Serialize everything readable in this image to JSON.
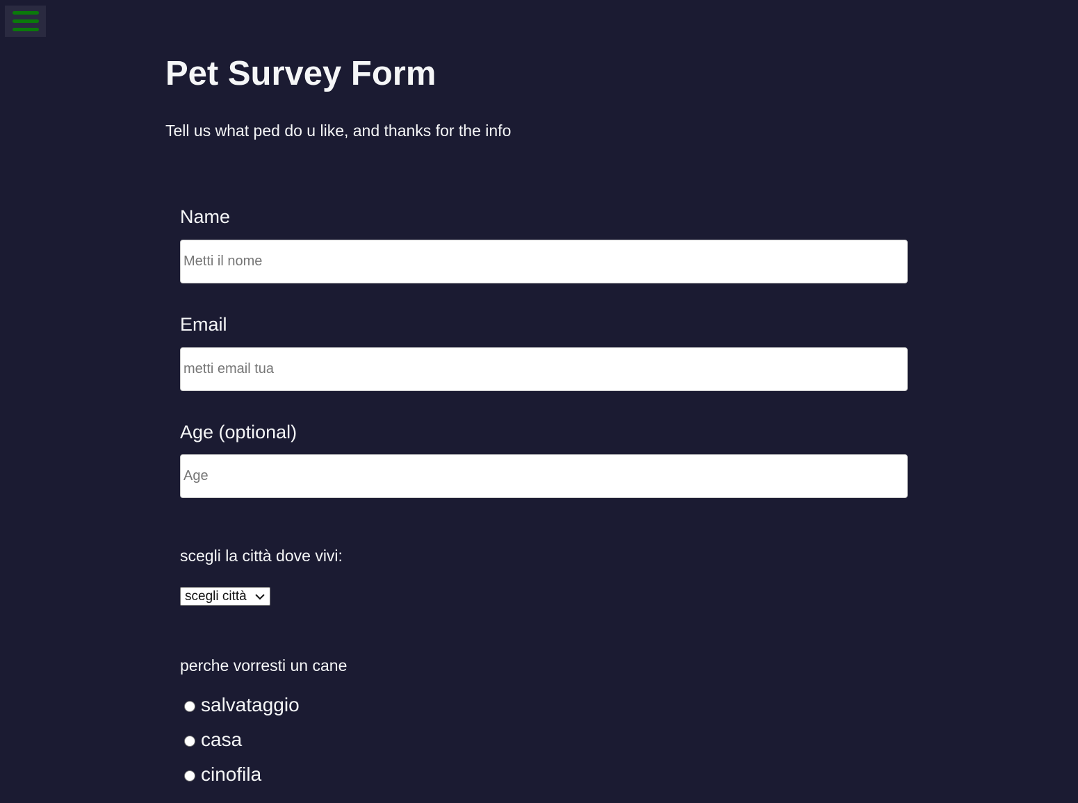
{
  "menu": {
    "icon": "hamburger-menu-icon",
    "color": "#0a7a0a"
  },
  "header": {
    "title": "Pet Survey Form",
    "description": "Tell us what ped do u like, and thanks for the info"
  },
  "form": {
    "name": {
      "label": "Name",
      "placeholder": "Metti il nome",
      "value": ""
    },
    "email": {
      "label": "Email",
      "placeholder": "metti email tua",
      "value": ""
    },
    "age": {
      "label": "Age (optional)",
      "placeholder": "Age",
      "value": ""
    },
    "city": {
      "label": "scegli la città dove vivi:",
      "selected": "scegli città"
    },
    "reason": {
      "label": "perche vorresti un cane",
      "options": [
        "salvataggio",
        "casa",
        "cinofila"
      ]
    }
  },
  "colors": {
    "background": "#1b1b32",
    "text": "#f5f6f7",
    "menu_bg": "#2a2a40"
  }
}
